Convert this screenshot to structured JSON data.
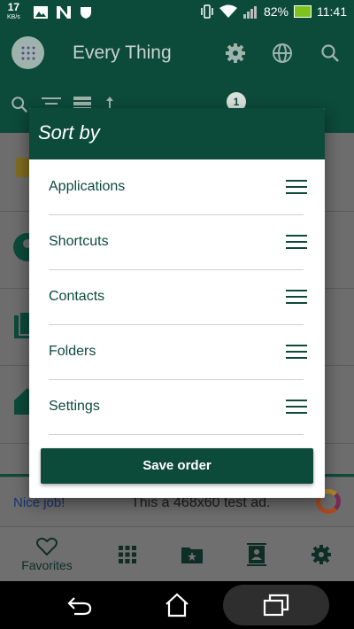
{
  "status_bar": {
    "net_speed": "17",
    "net_speed_unit": "KB/s",
    "battery": "82%",
    "time": "11:41"
  },
  "app_bar": {
    "title": "Every Thing",
    "icons": [
      "apps-grid-icon",
      "gear-icon",
      "globe-icon",
      "search-icon"
    ]
  },
  "toolbar": {
    "badge": "1",
    "icons": [
      "search-icon",
      "filter-icon",
      "view-list-icon",
      "sort-icon"
    ]
  },
  "dialog": {
    "title": "Sort by",
    "items": [
      {
        "label": "Applications"
      },
      {
        "label": "Shortcuts"
      },
      {
        "label": "Contacts"
      },
      {
        "label": "Folders"
      },
      {
        "label": "Settings"
      }
    ],
    "save_label": "Save order"
  },
  "ad": {
    "nice": "Nice job!",
    "text": "This a 468x60 test ad."
  },
  "bottom_nav": {
    "favorites_label": "Favorites",
    "icons": [
      "heart-icon",
      "apps-grid-icon",
      "star-folder-icon",
      "contact-card-icon",
      "gear-icon"
    ]
  },
  "colors": {
    "brand": "#0c4a3a",
    "dim_background": "#6d6d6d",
    "battery": "#7ec21d"
  }
}
